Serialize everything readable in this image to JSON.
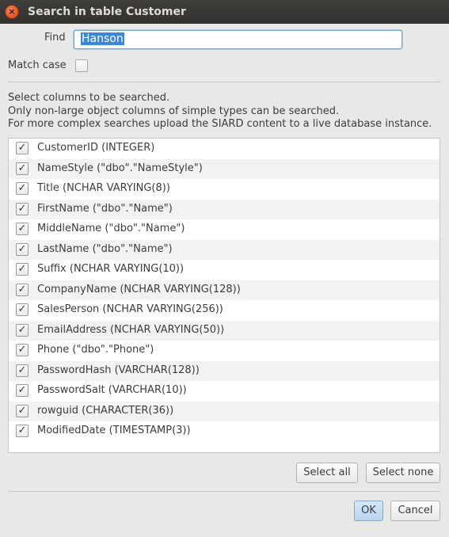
{
  "window": {
    "title": "Search in table Customer",
    "close_glyph": "×"
  },
  "find": {
    "label": "Find",
    "value": "Hanson"
  },
  "match_case": {
    "label": "Match case",
    "checked": false
  },
  "info": {
    "line1": "Select columns to be searched.",
    "line2": "Only non-large object columns of simple types can be searched.",
    "line3": "For more complex searches upload the SIARD content to a live database instance."
  },
  "columns": [
    {
      "label": "CustomerID (INTEGER)",
      "checked": true
    },
    {
      "label": "NameStyle (\"dbo\".\"NameStyle\")",
      "checked": true
    },
    {
      "label": "Title (NCHAR VARYING(8))",
      "checked": true
    },
    {
      "label": "FirstName (\"dbo\".\"Name\")",
      "checked": true
    },
    {
      "label": "MiddleName (\"dbo\".\"Name\")",
      "checked": true
    },
    {
      "label": "LastName (\"dbo\".\"Name\")",
      "checked": true
    },
    {
      "label": "Suffix (NCHAR VARYING(10))",
      "checked": true
    },
    {
      "label": "CompanyName (NCHAR VARYING(128))",
      "checked": true
    },
    {
      "label": "SalesPerson (NCHAR VARYING(256))",
      "checked": true
    },
    {
      "label": "EmailAddress (NCHAR VARYING(50))",
      "checked": true
    },
    {
      "label": "Phone (\"dbo\".\"Phone\")",
      "checked": true
    },
    {
      "label": "PasswordHash (VARCHAR(128))",
      "checked": true
    },
    {
      "label": "PasswordSalt (VARCHAR(10))",
      "checked": true
    },
    {
      "label": "rowguid (CHARACTER(36))",
      "checked": true
    },
    {
      "label": "ModifiedDate (TIMESTAMP(3))",
      "checked": true
    }
  ],
  "check_glyph": "✓",
  "buttons": {
    "select_all": "Select all",
    "select_none": "Select none",
    "ok": "OK",
    "cancel": "Cancel"
  },
  "colors": {
    "titlebar": "#3c3b37",
    "close": "#e95420",
    "selection": "#3b86d6",
    "ok_button": "#c5dff5"
  }
}
